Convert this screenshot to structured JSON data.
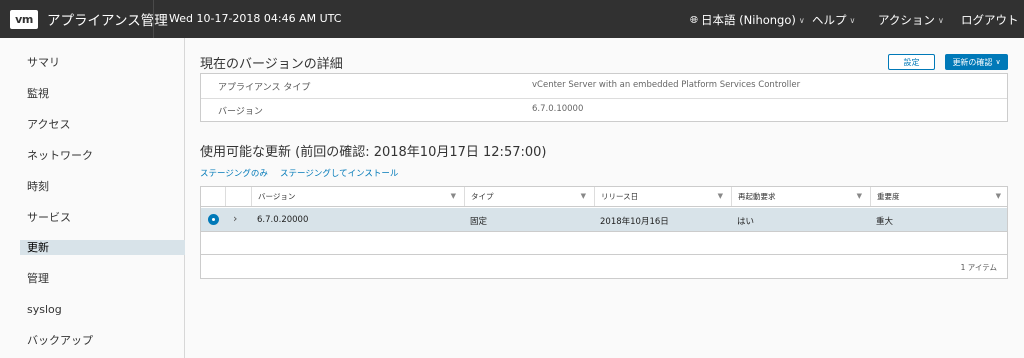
{
  "header": {
    "logo": "vm",
    "title": "アプライアンス管理",
    "datetime": "Wed 10-17-2018 04:46 AM UTC",
    "language": "日本語 (Nihongo)",
    "help": "ヘルプ",
    "actions": "アクション",
    "logout": "ログアウト"
  },
  "sidebar": {
    "items": [
      {
        "label": "サマリ"
      },
      {
        "label": "監視"
      },
      {
        "label": "アクセス"
      },
      {
        "label": "ネットワーク"
      },
      {
        "label": "時刻"
      },
      {
        "label": "サービス"
      },
      {
        "label": "更新",
        "active": true
      },
      {
        "label": "管理"
      },
      {
        "label": "syslog"
      },
      {
        "label": "バックアップ"
      }
    ]
  },
  "current": {
    "title": "現在のバージョンの詳細",
    "settings_button": "設定",
    "check_updates_button": "更新の確認",
    "rows": [
      {
        "key": "アプライアンス タイプ",
        "value": "vCenter Server with an embedded Platform Services Controller"
      },
      {
        "key": "バージョン",
        "value": "6.7.0.10000"
      }
    ]
  },
  "available": {
    "title": "使用可能な更新 (前回の確認: 2018年10月17日 12:57:00)",
    "links": [
      "ステージングのみ",
      "ステージングしてインストール"
    ],
    "columns": [
      "バージョン",
      "タイプ",
      "リリース日",
      "再起動要求",
      "重要度"
    ],
    "rows": [
      {
        "version": "6.7.0.20000",
        "type": "固定",
        "release_date": "2018年10月16日",
        "reboot": "はい",
        "severity": "重大"
      }
    ],
    "footer": "1 アイテム"
  },
  "colors": {
    "header_bg": "#313131",
    "accent": "#0079b8",
    "selected_row": "#d8e3e9"
  }
}
